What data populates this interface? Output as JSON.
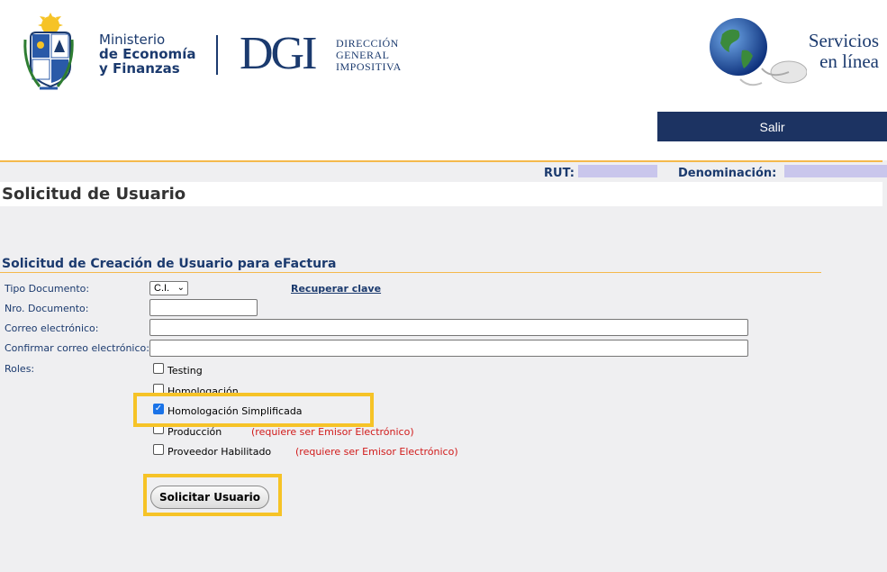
{
  "header": {
    "ministry_line1": "Ministerio",
    "ministry_line2": "de Economía",
    "ministry_line3": "y Finanzas",
    "dgi_abbr": "DGI",
    "dgi_line1": "DIRECCIÓN",
    "dgi_line2": "GENERAL",
    "dgi_line3": "IMPOSITIVA",
    "services_line1": "Servicios",
    "services_line2": "en línea",
    "logout_label": "Salir"
  },
  "info_bar": {
    "rut_label": "RUT:",
    "denominacion_label": "Denominación:"
  },
  "page": {
    "title": "Solicitud de Usuario",
    "section_title": "Solicitud de Creación de Usuario para eFactura"
  },
  "form": {
    "tipo_documento_label": "Tipo Documento:",
    "tipo_documento_value": "C.I.",
    "recuperar_label": "Recuperar clave",
    "nro_documento_label": "Nro. Documento:",
    "correo_label": "Correo electrónico:",
    "confirmar_correo_label": "Confirmar correo electrónico:",
    "roles_label": "Roles:",
    "roles": [
      {
        "label": "Testing",
        "checked": false,
        "note": ""
      },
      {
        "label": "Homologación",
        "checked": false,
        "note": ""
      },
      {
        "label": "Homologación Simplificada",
        "checked": true,
        "note": ""
      },
      {
        "label": "Producción",
        "checked": false,
        "note": "(requiere ser Emisor Electrónico)"
      },
      {
        "label": "Proveedor Habilitado",
        "checked": false,
        "note": "(requiere ser Emisor Electrónico)"
      }
    ],
    "submit_label": "Solicitar Usuario"
  },
  "colors": {
    "brand_navy": "#1c3362",
    "accent_orange": "#f4b94c",
    "highlight_yellow": "#f6c327",
    "note_red": "#d11a1a"
  }
}
